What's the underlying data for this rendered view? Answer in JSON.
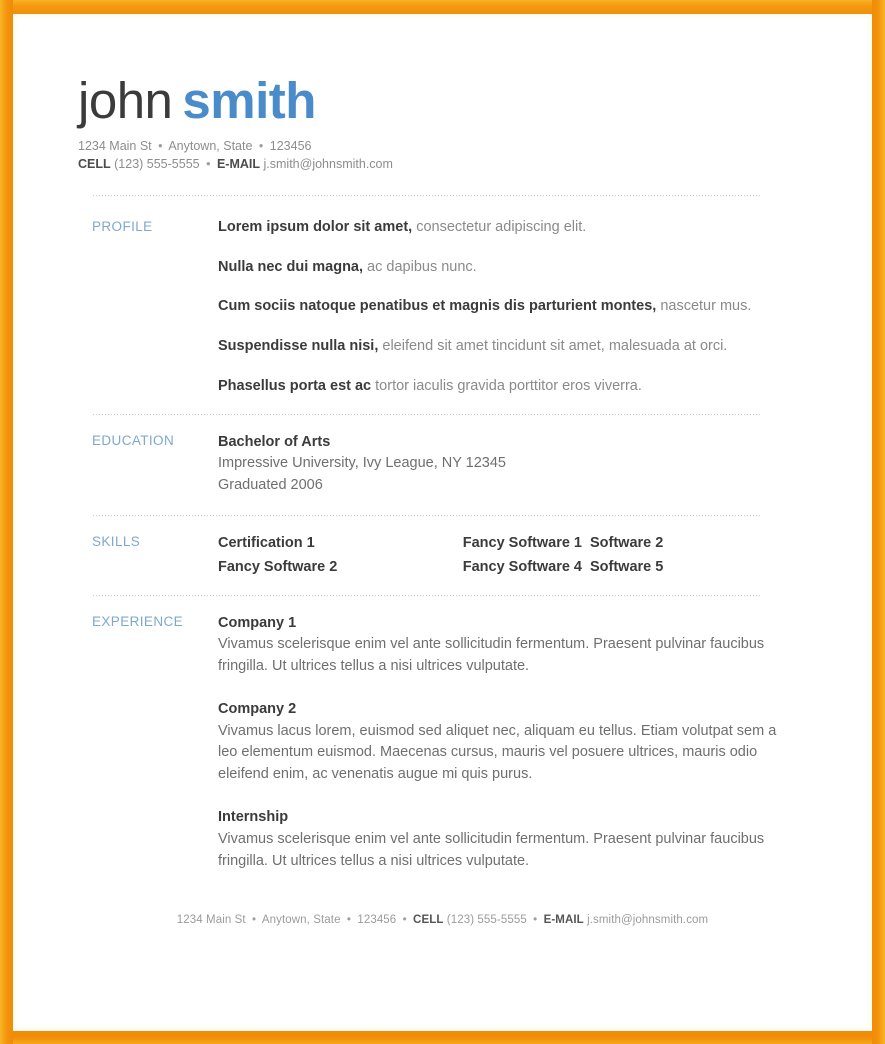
{
  "theme": {
    "frame_color": "#f3930d",
    "accent_blue": "#4a8bc9",
    "section_label_color": "#7fa8cd",
    "body_text_color": "#6f6f6f",
    "heading_text_color": "#3b3b3b"
  },
  "header": {
    "first_name": "john",
    "last_name": "smith",
    "address_line": {
      "street": "1234 Main St",
      "city_state": "Anytown, State",
      "zip": "123456",
      "separator": "•"
    },
    "contact_line": {
      "cell_label": "CELL",
      "cell_value": "(123) 555-5555",
      "email_label": "E-MAIL",
      "email_value": "j.smith@johnsmith.com",
      "separator": "•"
    }
  },
  "sections": {
    "profile": {
      "label": "PROFILE",
      "items": [
        {
          "lead": "Lorem ipsum dolor sit amet,",
          "rest": " consectetur adipiscing elit."
        },
        {
          "lead": "Nulla nec dui magna,",
          "rest": " ac dapibus nunc."
        },
        {
          "lead": "Cum sociis natoque penatibus et magnis dis parturient montes,",
          "rest": " nascetur mus."
        },
        {
          "lead": "Suspendisse nulla nisi,",
          "rest": " eleifend sit amet tincidunt sit amet, malesuada at orci."
        },
        {
          "lead": "Phasellus porta est ac",
          "rest": " tortor iaculis gravida porttitor eros viverra."
        }
      ]
    },
    "education": {
      "label": "EDUCATION",
      "degree": "Bachelor of Arts",
      "institution": "Impressive University, Ivy League, NY 12345",
      "graduation": "Graduated 2006"
    },
    "skills": {
      "label": "SKILLS",
      "items": [
        "Certification 1",
        "Fancy Software 1",
        "Software 2",
        "Fancy Software 2",
        "Fancy Software 4",
        "Software 5"
      ]
    },
    "experience": {
      "label": "EXPERIENCE",
      "jobs": [
        {
          "title": "Company 1",
          "description": "Vivamus scelerisque enim vel ante sollicitudin fermentum. Praesent pulvinar faucibus fringilla. Ut ultrices tellus a nisi ultrices vulputate."
        },
        {
          "title": "Company 2",
          "description": "Vivamus lacus lorem, euismod sed aliquet nec, aliquam eu tellus. Etiam volutpat sem a leo elementum euismod. Maecenas cursus, mauris vel posuere ultrices, mauris odio eleifend enim, ac venenatis augue mi quis purus."
        },
        {
          "title": "Internship",
          "description": "Vivamus scelerisque enim vel ante sollicitudin fermentum. Praesent pulvinar faucibus fringilla. Ut ultrices tellus a nisi ultrices vulputate."
        }
      ]
    }
  },
  "footer": {
    "street": "1234 Main St",
    "city_state": "Anytown, State",
    "zip": "123456",
    "cell_label": "CELL",
    "cell_value": "(123) 555-5555",
    "email_label": "E-MAIL",
    "email_value": "j.smith@johnsmith.com",
    "separator": "•"
  }
}
